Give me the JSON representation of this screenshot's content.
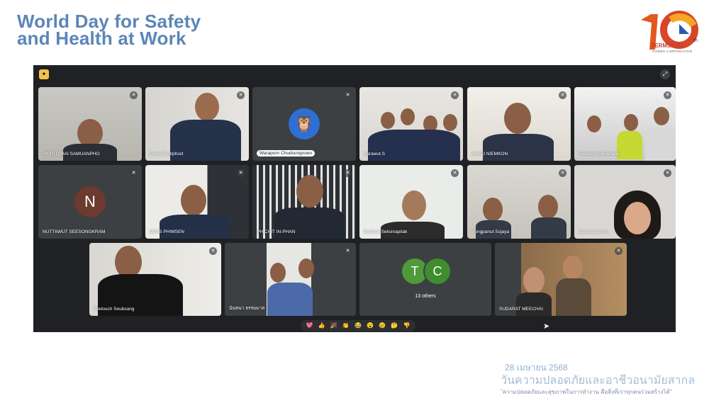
{
  "header": {
    "title_line1": "World Day for Safety",
    "title_line2": "and Health at Work",
    "logo_word": "SERMSANG",
    "logo_sub": "POWER CORPORATION",
    "logo_number": "10",
    "logo_suffix": "th"
  },
  "meeting": {
    "participants": [
      {
        "name": "PICHITCHAI SAMUANPHO"
      },
      {
        "name": "Prem Photiphisit"
      },
      {
        "name": "Waraporn Chudsungnoen",
        "avatar_icon": "owl-avatar-icon"
      },
      {
        "name": "Sarawut.S"
      },
      {
        "name": "AWAD NIEMKON"
      },
      {
        "name": "Teetouch Seubsang"
      },
      {
        "name": "NUTTAWUT SEESONGKRAM",
        "initial": "N"
      },
      {
        "name": "OPAS PHIMSEN"
      },
      {
        "name": "PHICHIT IN-PHAN"
      },
      {
        "name": "Sudarat Seksinapitak"
      },
      {
        "name": "Pongpanut Sujaya"
      },
      {
        "name": "Vanussaton S."
      },
      {
        "name": "Teetouch Seubsang"
      },
      {
        "name": "นันทนา ธรรมมาส"
      },
      {
        "name": "13 others",
        "initials": [
          "T",
          "C"
        ]
      },
      {
        "name": "SUDARAT MEECHAI"
      }
    ],
    "reactions": [
      "💖",
      "👍",
      "🎉",
      "👏",
      "😂",
      "😮",
      "😢",
      "🤔",
      "👎"
    ]
  },
  "footer": {
    "date": "28 เมษายน 2568",
    "day_name": "วันความปลอดภัยและอาชีวอนามัยสากล",
    "slogan": "\"ความปลอดภัยและสุขภาพในการทำงาน คือสิ่งที่เราทุกคนร่วมสร้างได้\""
  },
  "colors": {
    "title": "#5b86b8",
    "meet_bg": "#202124",
    "tile_bg": "#3c4043",
    "avatar_n": "#6d3a2e",
    "avatar_t": "#4f9a3a",
    "avatar_c": "#3f8d2f"
  }
}
